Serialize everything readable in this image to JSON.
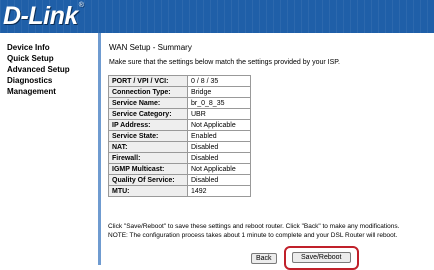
{
  "brand": {
    "logo_text": "D-Link",
    "logo_mark": "®"
  },
  "sidebar": {
    "items": [
      {
        "label": "Device Info"
      },
      {
        "label": "Quick Setup"
      },
      {
        "label": "Advanced Setup"
      },
      {
        "label": "Diagnostics"
      },
      {
        "label": "Management"
      }
    ]
  },
  "main": {
    "title": "WAN Setup - Summary",
    "description": "Make sure that the settings below match the settings provided by your ISP.",
    "rows": [
      {
        "label": "PORT / VPI / VCI:",
        "value": "0 / 8 / 35"
      },
      {
        "label": "Connection Type:",
        "value": "Bridge"
      },
      {
        "label": "Service Name:",
        "value": "br_0_8_35"
      },
      {
        "label": "Service Category:",
        "value": "UBR"
      },
      {
        "label": "IP Address:",
        "value": "Not Applicable"
      },
      {
        "label": "Service State:",
        "value": "Enabled"
      },
      {
        "label": "NAT:",
        "value": "Disabled"
      },
      {
        "label": "Firewall:",
        "value": "Disabled"
      },
      {
        "label": "IGMP Multicast:",
        "value": "Not Applicable"
      },
      {
        "label": "Quality Of Service:",
        "value": "Disabled"
      },
      {
        "label": "MTU:",
        "value": "1492"
      }
    ],
    "note_line1": "Click \"Save/Reboot\" to save these settings and reboot router. Click \"Back\" to make any modifications.",
    "note_line2": "NOTE: The configuration process takes about 1 minute to complete and your DSL Router will reboot."
  },
  "buttons": {
    "back_label": "Back",
    "save_label": "Save/Reboot"
  },
  "colors": {
    "banner": "#1f5fa8",
    "divider": "#6f9bd0",
    "highlight": "#c0202a"
  }
}
